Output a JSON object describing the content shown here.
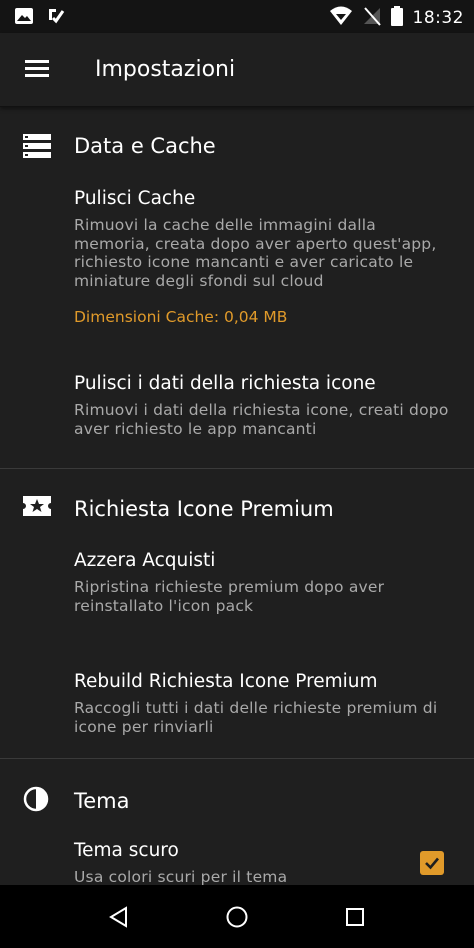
{
  "status_bar": {
    "time": "18:32",
    "left_icons": [
      "image-icon",
      "download-check-icon"
    ],
    "right_icons": [
      "wifi-icon",
      "no-signal-icon",
      "battery-icon"
    ]
  },
  "app_bar": {
    "title": "Impostazioni",
    "menu_icon": "hamburger-menu-icon"
  },
  "sections": [
    {
      "title": "Data e Cache",
      "icon": "storage-icon",
      "items": [
        {
          "title": "Pulisci Cache",
          "description": "Rimuovi la cache delle immagini dalla memoria, creata dopo aver aperto quest'app, richiesto icone mancanti e aver caricato le miniature degli sfondi sul cloud",
          "extra": "Dimensioni Cache: 0,04 MB"
        },
        {
          "title": "Pulisci i dati della richiesta icone",
          "description": "Rimuovi i dati della richiesta icone, creati dopo aver richiesto le app mancanti"
        }
      ]
    },
    {
      "title": "Richiesta Icone Premium",
      "icon": "ticket-star-icon",
      "items": [
        {
          "title": "Azzera Acquisti",
          "description": "Ripristina richieste premium dopo aver reinstallato l'icon pack"
        },
        {
          "title": "Rebuild Richiesta Icone Premium",
          "description": "Raccogli tutti i dati delle richieste premium di icone per rinviarli"
        }
      ]
    },
    {
      "title": "Tema",
      "icon": "contrast-drop-icon",
      "items": [
        {
          "title": "Tema scuro",
          "description": "Usa colori scuri per il tema",
          "checked": true
        }
      ]
    }
  ],
  "nav_bar": {
    "buttons": [
      "back-icon",
      "home-icon",
      "recents-icon"
    ]
  },
  "colors": {
    "background": "#1f1f1f",
    "accent": "#e09a2a",
    "secondary_text": "#a9a9a9",
    "divider": "#3a3a3a"
  }
}
